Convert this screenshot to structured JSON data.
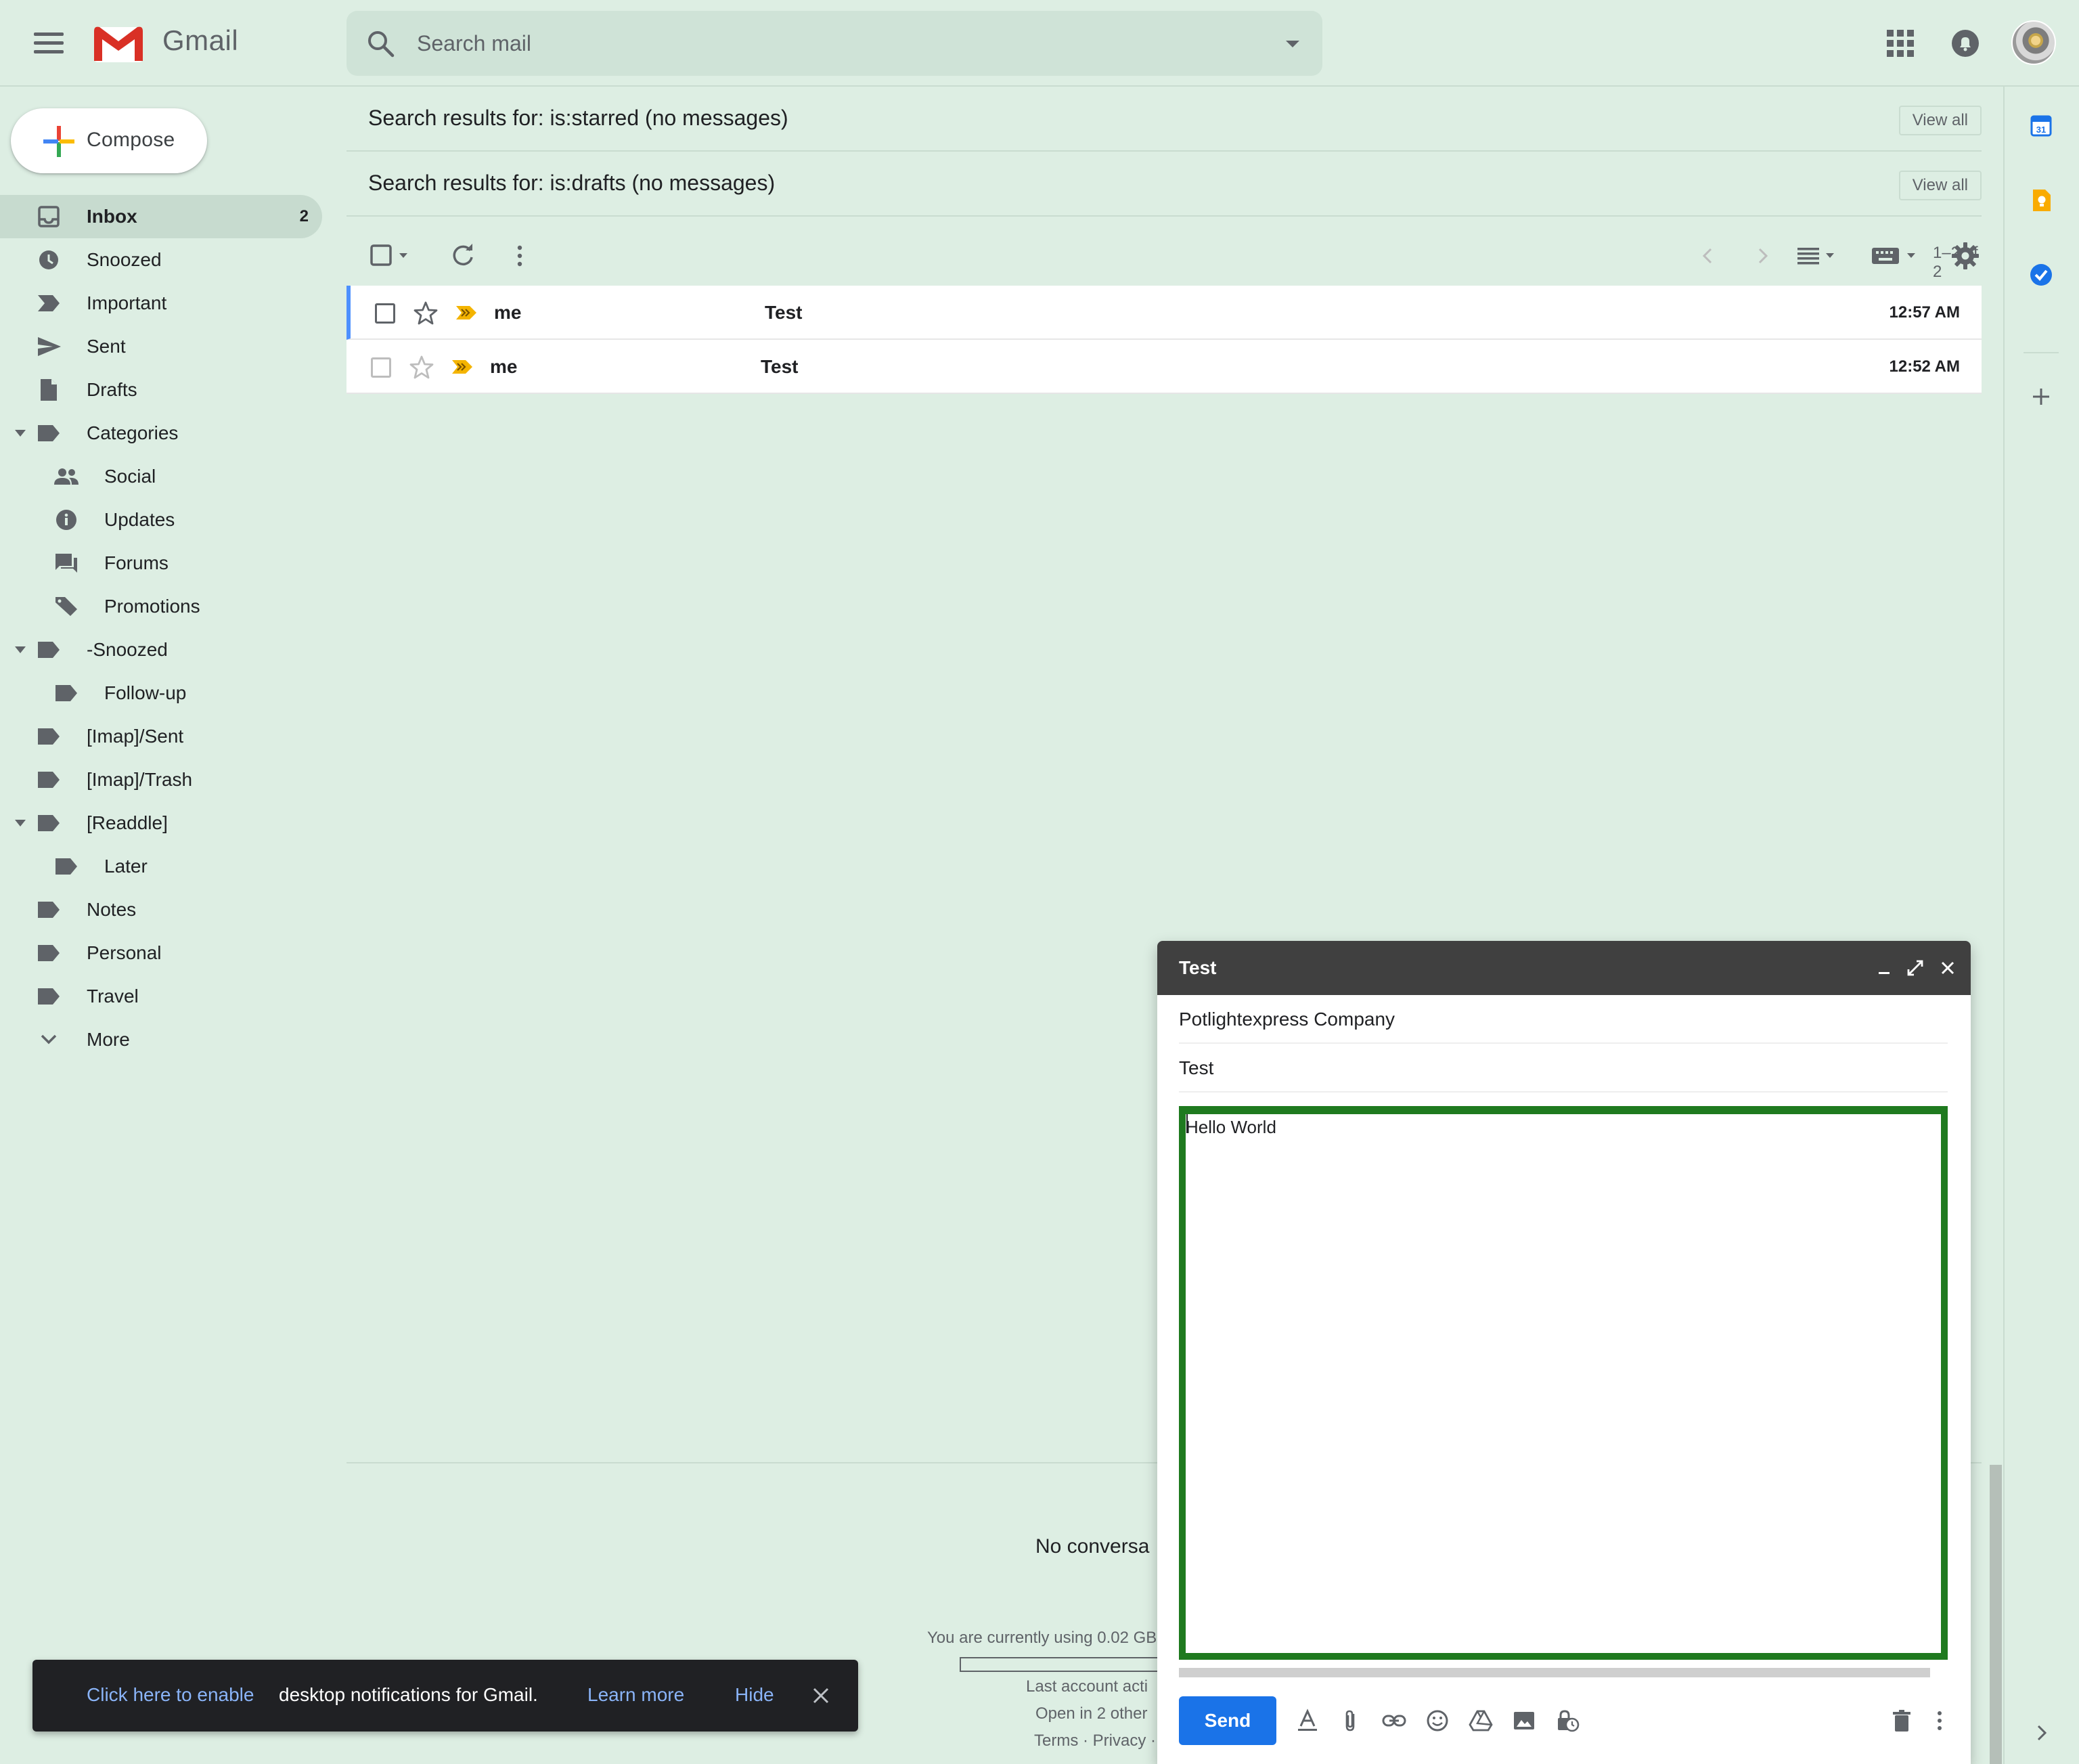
{
  "app": {
    "name": "Gmail"
  },
  "search": {
    "placeholder": "Search mail"
  },
  "compose_button": {
    "label": "Compose"
  },
  "sidebar": {
    "items": [
      {
        "label": "Inbox",
        "count": "2",
        "icon": "inbox-icon",
        "active": true
      },
      {
        "label": "Snoozed",
        "icon": "clock-icon"
      },
      {
        "label": "Important",
        "icon": "important-icon"
      },
      {
        "label": "Sent",
        "icon": "send-icon"
      },
      {
        "label": "Drafts",
        "icon": "draft-icon"
      },
      {
        "label": "Categories",
        "icon": "label-icon",
        "expandable": true
      },
      {
        "label": "Social",
        "icon": "people-icon",
        "sub": true
      },
      {
        "label": "Updates",
        "icon": "info-icon",
        "sub": true
      },
      {
        "label": "Forums",
        "icon": "forum-icon",
        "sub": true
      },
      {
        "label": "Promotions",
        "icon": "tag-icon",
        "sub": true
      },
      {
        "label": "-Snoozed",
        "icon": "label-icon",
        "expandable": true
      },
      {
        "label": "Follow-up",
        "icon": "label-icon",
        "sub": true
      },
      {
        "label": "[Imap]/Sent",
        "icon": "label-icon"
      },
      {
        "label": "[Imap]/Trash",
        "icon": "label-icon"
      },
      {
        "label": "[Readdle]",
        "icon": "label-icon",
        "expandable": true
      },
      {
        "label": "Later",
        "icon": "label-icon",
        "sub": true
      },
      {
        "label": "Notes",
        "icon": "label-icon"
      },
      {
        "label": "Personal",
        "icon": "label-icon"
      },
      {
        "label": "Travel",
        "icon": "label-icon"
      },
      {
        "label": "More",
        "icon": "chevron-down-icon"
      }
    ]
  },
  "sections": {
    "starred": {
      "title": "Search results for: is:starred (no messages)",
      "view_all": "View all"
    },
    "drafts": {
      "title": "Search results for: is:drafts (no messages)",
      "view_all": "View all"
    }
  },
  "toolbar": {
    "pager": "1–2 of 2"
  },
  "messages": [
    {
      "from": "me",
      "subject": "Test",
      "time": "12:57 AM"
    },
    {
      "from": "me",
      "subject": "Test",
      "time": "12:52 AM"
    }
  ],
  "footer": {
    "no_conversations": "No conversa",
    "usage": "You are currently using 0.02 GB",
    "last_activity": "Last account acti",
    "open_in": "Open in 2 other",
    "terms": "Terms · Privacy ·"
  },
  "compose_window": {
    "title": "Test",
    "to": "Potlightexpress Company",
    "subject": "Test",
    "body": "Hello World",
    "send_label": "Send"
  },
  "snackbar": {
    "enable_link": "Click here to enable",
    "message": "desktop notifications for Gmail.",
    "learn_more": "Learn more",
    "hide": "Hide"
  },
  "colors": {
    "background": "#ddeee3",
    "accent": "#1a73e8",
    "compose_header": "#404040",
    "focus_border": "#1f7a1f",
    "important_marker": "#f4b400"
  }
}
